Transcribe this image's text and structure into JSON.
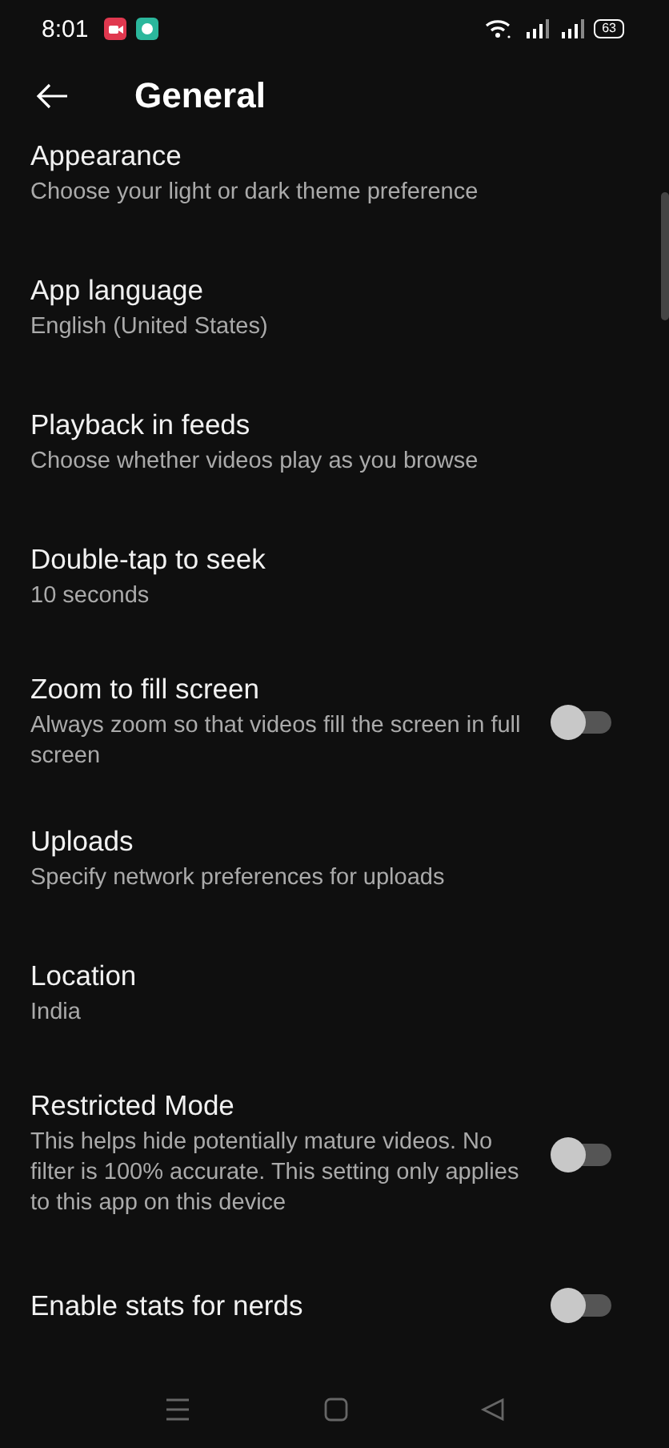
{
  "status_bar": {
    "time": "8:01",
    "battery": "63"
  },
  "header": {
    "title": "General"
  },
  "settings": [
    {
      "kind": "text",
      "title": "Appearance",
      "subtitle": "Choose your light or dark theme preference"
    },
    {
      "kind": "text",
      "title": "App language",
      "subtitle": "English (United States)"
    },
    {
      "kind": "text",
      "title": "Playback in feeds",
      "subtitle": "Choose whether videos play as you browse"
    },
    {
      "kind": "text",
      "title": "Double-tap to seek",
      "subtitle": "10 seconds"
    },
    {
      "kind": "toggle",
      "title": "Zoom to fill screen",
      "subtitle": "Always zoom so that videos fill the screen in full screen",
      "on": false
    },
    {
      "kind": "text",
      "title": "Uploads",
      "subtitle": "Specify network preferences for uploads"
    },
    {
      "kind": "text",
      "title": "Location",
      "subtitle": "India"
    },
    {
      "kind": "toggle",
      "title": "Restricted Mode",
      "subtitle": "This helps hide potentially mature videos. No filter is 100% accurate. This setting only applies to this app on this device",
      "on": false
    },
    {
      "kind": "toggle",
      "title": "Enable stats for nerds",
      "on": false
    }
  ]
}
